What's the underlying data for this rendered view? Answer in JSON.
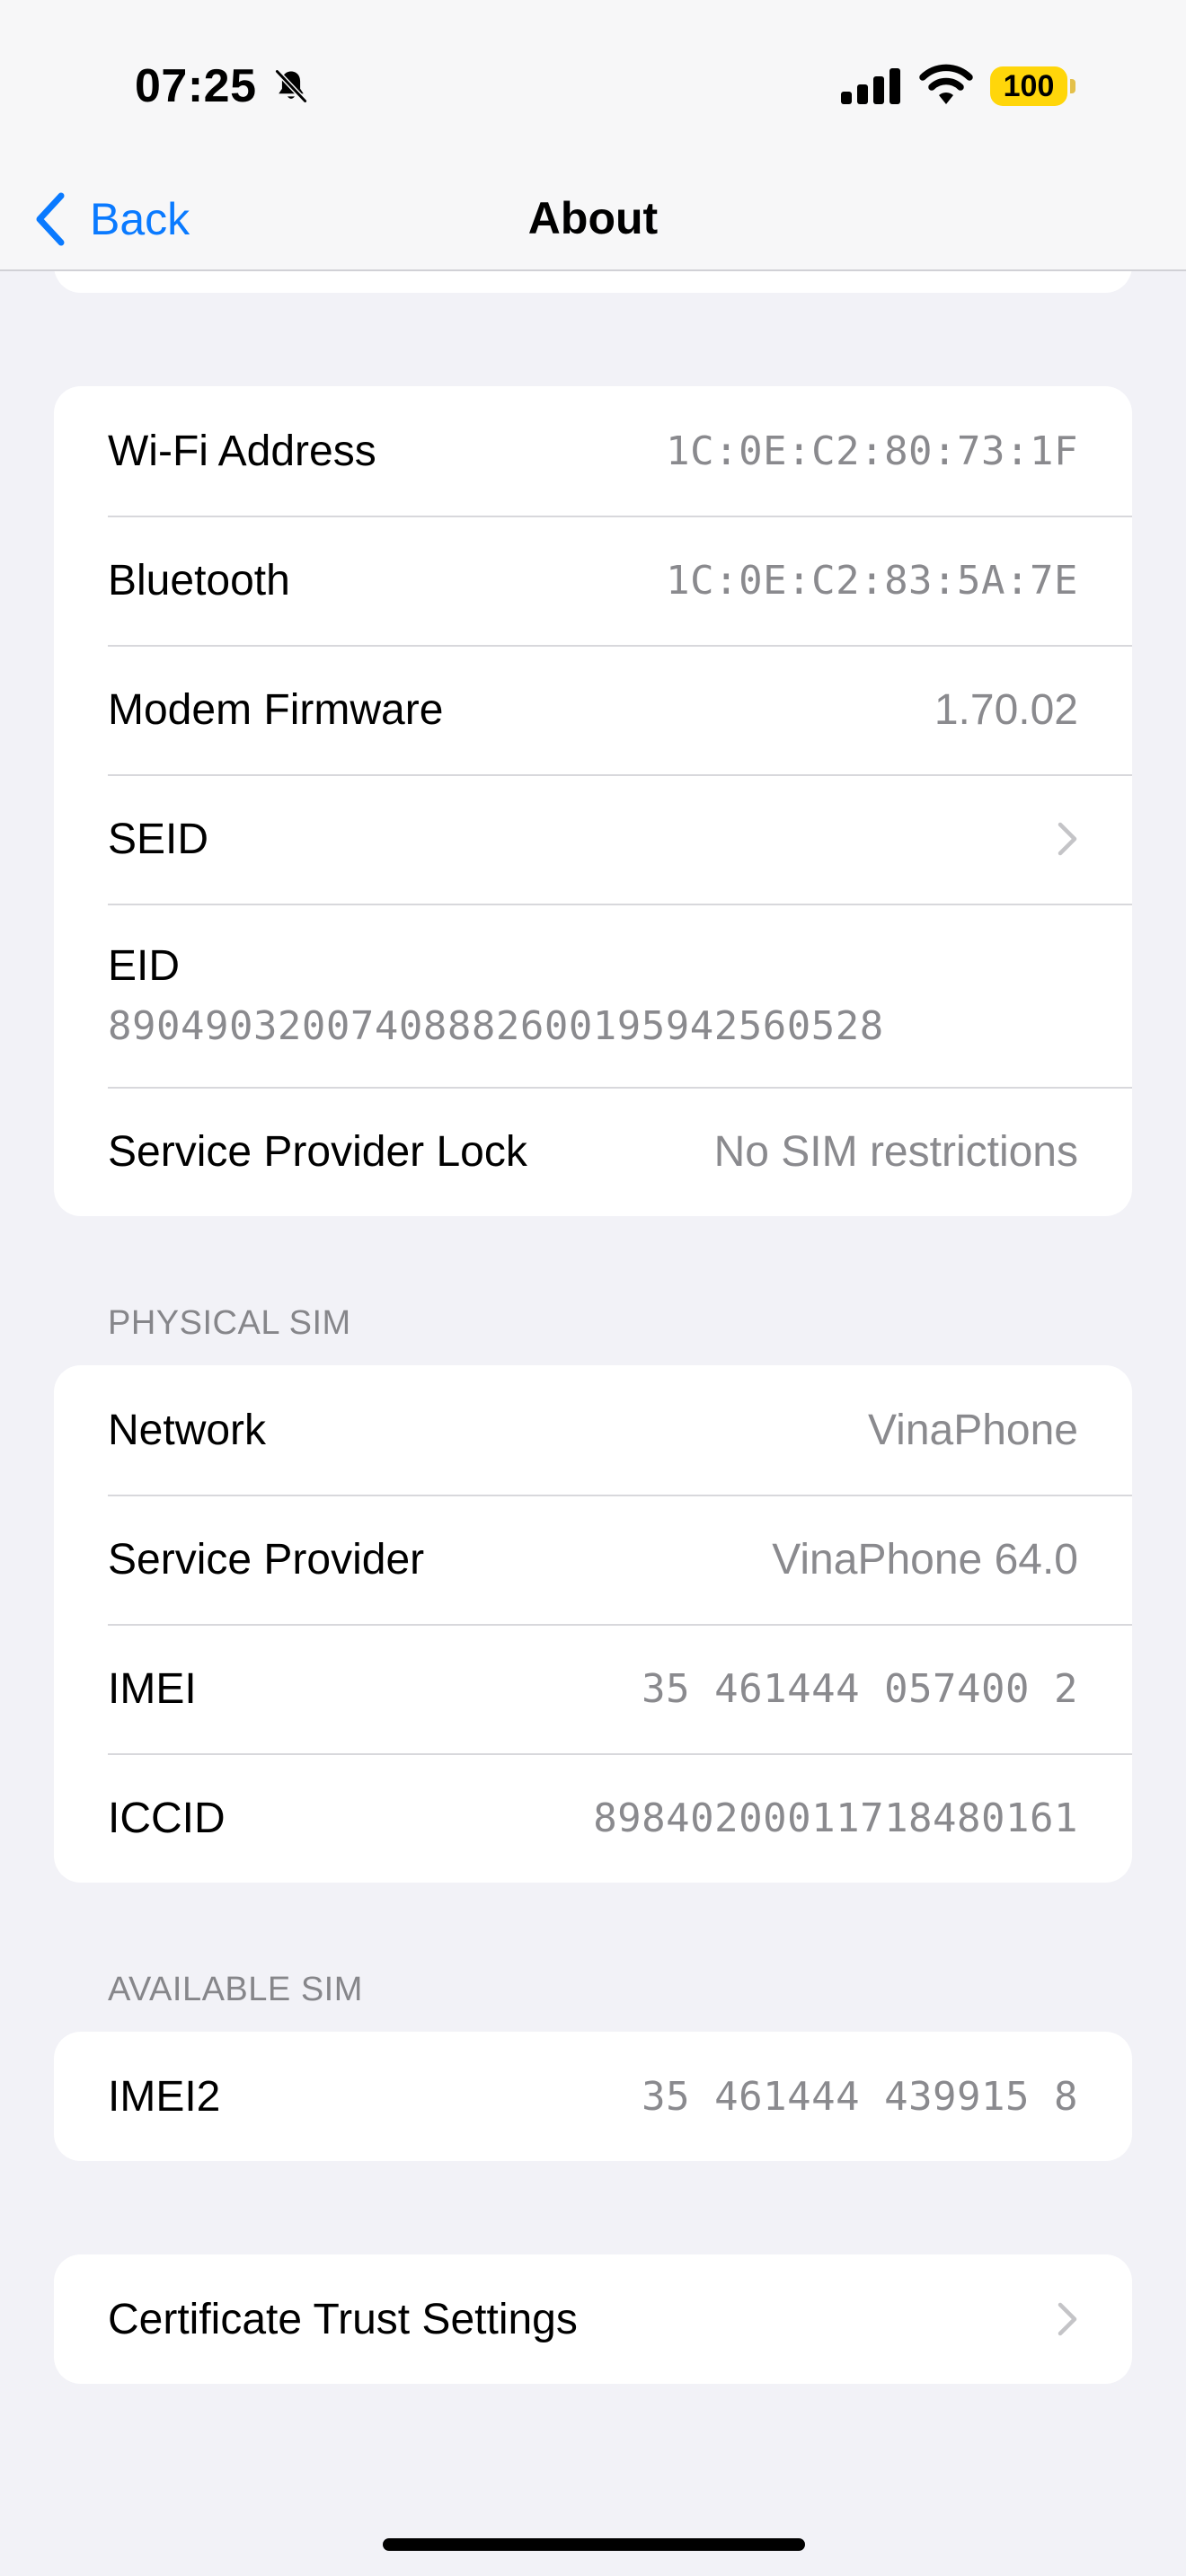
{
  "status_bar": {
    "time": "07:25",
    "battery": "100",
    "mute_icon": "bell-slash-icon",
    "signal_icon": "cellular-signal-icon",
    "wifi_icon": "wifi-icon",
    "battery_color": "#ffd60a"
  },
  "nav": {
    "back_label": "Back",
    "title": "About",
    "accent_color": "#0a7aff"
  },
  "groups": {
    "device": {
      "wifi_address": {
        "label": "Wi-Fi Address",
        "value": "1C:0E:C2:80:73:1F"
      },
      "bluetooth": {
        "label": "Bluetooth",
        "value": "1C:0E:C2:83:5A:7E"
      },
      "modem_firmware": {
        "label": "Modem Firmware",
        "value": "1.70.02"
      },
      "seid": {
        "label": "SEID"
      },
      "eid": {
        "label": "EID",
        "value": "89049032007408882600195942560528"
      },
      "service_provider_lock": {
        "label": "Service Provider Lock",
        "value": "No SIM restrictions"
      }
    },
    "physical_sim": {
      "header": "PHYSICAL SIM",
      "network": {
        "label": "Network",
        "value": "VinaPhone"
      },
      "service_provider": {
        "label": "Service Provider",
        "value": "VinaPhone 64.0"
      },
      "imei": {
        "label": "IMEI",
        "value": "35 461444 057400 2"
      },
      "iccid": {
        "label": "ICCID",
        "value": "89840200011718480161"
      }
    },
    "available_sim": {
      "header": "AVAILABLE SIM",
      "imei2": {
        "label": "IMEI2",
        "value": "35 461444 439915 8"
      }
    },
    "certificates": {
      "certificate_trust": {
        "label": "Certificate Trust Settings"
      }
    }
  }
}
